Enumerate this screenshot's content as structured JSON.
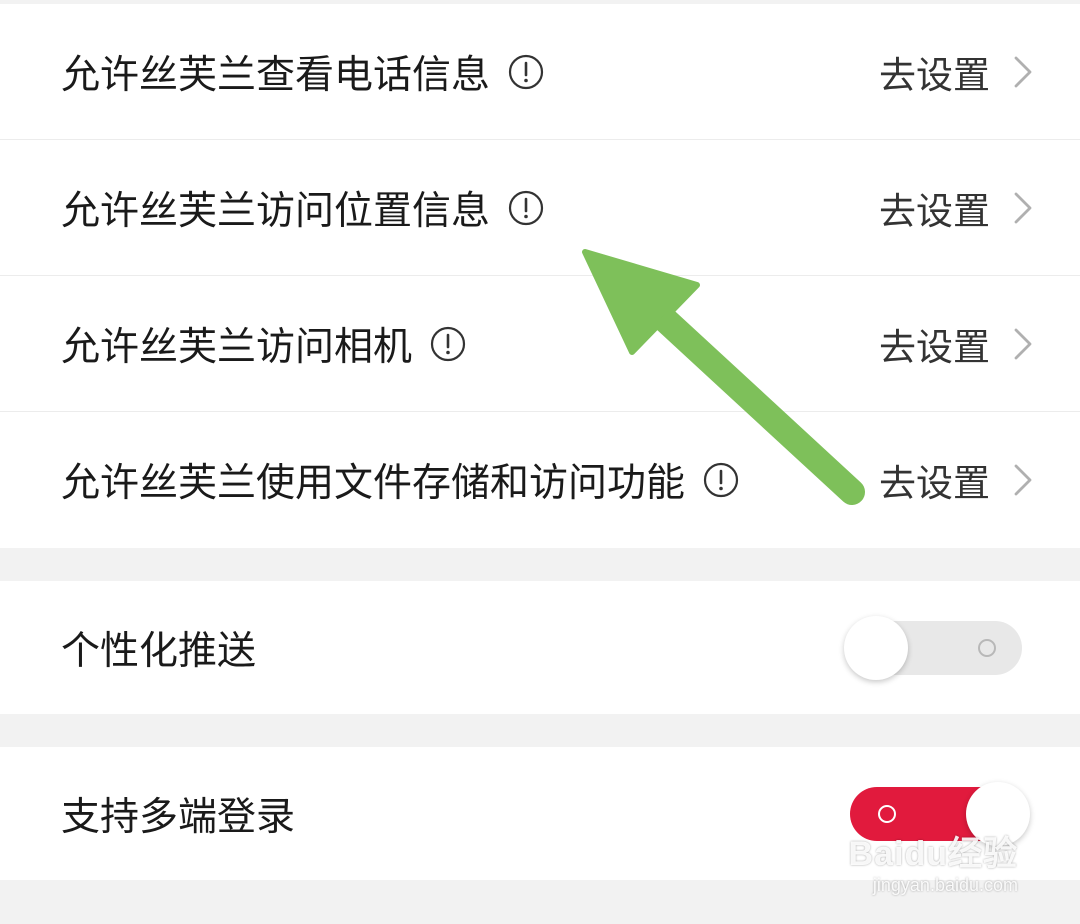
{
  "permissions": [
    {
      "label": "允许丝芙兰查看电话信息",
      "action": "去设置"
    },
    {
      "label": "允许丝芙兰访问位置信息",
      "action": "去设置"
    },
    {
      "label": "允许丝芙兰访问相机",
      "action": "去设置"
    },
    {
      "label": "允许丝芙兰使用文件存储和访问功能",
      "action": "去设置"
    }
  ],
  "toggles": {
    "personalized_push": {
      "label": "个性化推送",
      "state": "off"
    },
    "multi_device_login": {
      "label": "支持多端登录",
      "state": "on"
    }
  },
  "colors": {
    "toggle_on": "#e11a3d",
    "toggle_off": "#e8e8e8",
    "annotation_arrow": "#7ec05a",
    "page_background": "#f2f2f2"
  },
  "icons": {
    "info": "circle-exclamation",
    "chevron": "chevron-right"
  },
  "watermark": {
    "brand": "Baidu经验",
    "url": "jingyan.baidu.com"
  }
}
